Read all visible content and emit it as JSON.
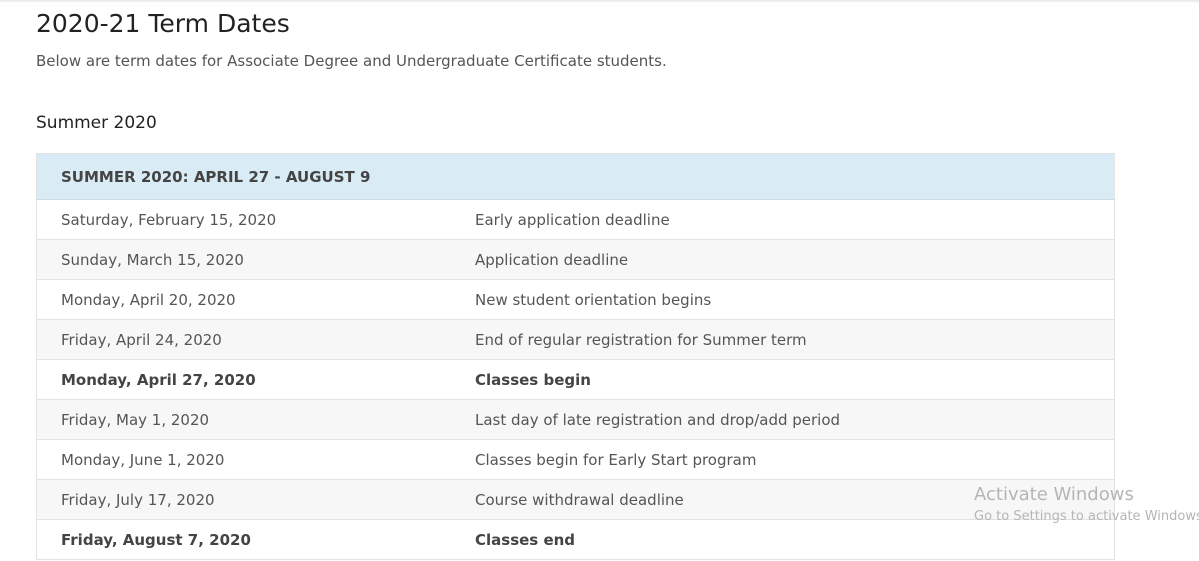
{
  "page": {
    "title": "2020-21 Term Dates",
    "intro": "Below are term dates for Associate Degree and Undergraduate Certificate students."
  },
  "section": {
    "title": "Summer 2020",
    "table_header": "SUMMER 2020: APRIL 27 - AUGUST 9",
    "rows": [
      {
        "date": "Saturday, February 15, 2020",
        "event": "Early application deadline",
        "bold": false
      },
      {
        "date": "Sunday, March 15, 2020",
        "event": "Application deadline",
        "bold": false
      },
      {
        "date": "Monday, April 20, 2020",
        "event": "New student orientation begins",
        "bold": false
      },
      {
        "date": "Friday, April 24, 2020",
        "event": "End of regular registration for Summer term",
        "bold": false
      },
      {
        "date": "Monday, April 27, 2020",
        "event": "Classes begin",
        "bold": true
      },
      {
        "date": "Friday, May 1, 2020",
        "event": "Last day of late registration and drop/add period",
        "bold": false
      },
      {
        "date": "Monday, June 1, 2020",
        "event": "Classes begin for Early Start program",
        "bold": false
      },
      {
        "date": "Friday, July 17, 2020",
        "event": "Course withdrawal deadline",
        "bold": false
      },
      {
        "date": "Friday, August 7, 2020",
        "event": "Classes end",
        "bold": true
      }
    ]
  },
  "watermark": {
    "title": "Activate Windows",
    "subtitle": "Go to Settings to activate Windows."
  }
}
